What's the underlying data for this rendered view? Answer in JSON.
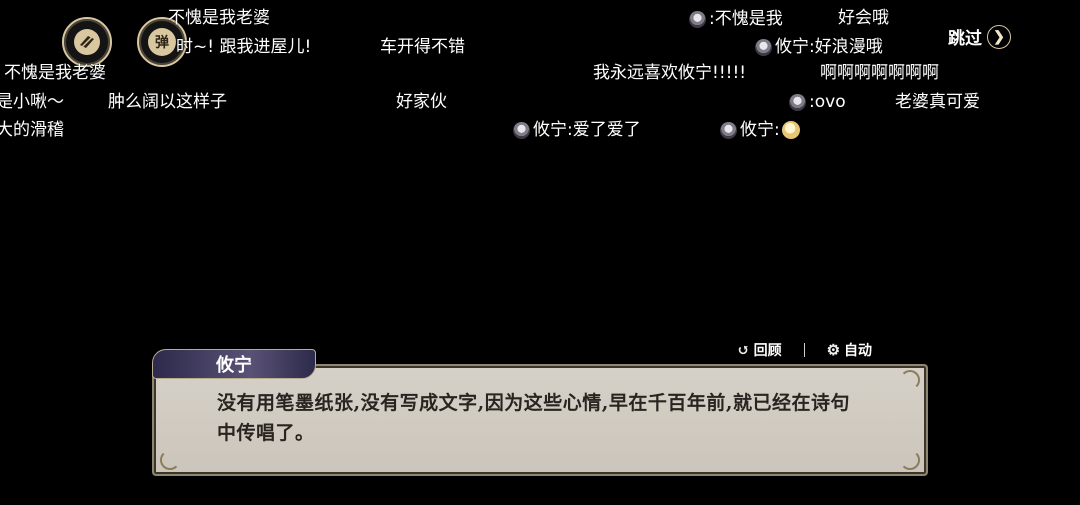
{
  "danmaku": [
    {
      "text": "不愧是我老婆",
      "avatar": false
    },
    {
      "text": "时~!  跟我进屋儿!",
      "avatar": false
    },
    {
      "text": "车开得不错",
      "avatar": false
    },
    {
      "text": "不愧是我老婆",
      "avatar": false
    },
    {
      "text": "是小啾～",
      "avatar": false
    },
    {
      "text": "肿么阔以这样子",
      "avatar": false
    },
    {
      "text": "好家伙",
      "avatar": false
    },
    {
      "text": "大的滑稽",
      "avatar": false
    },
    {
      "text": ":不愧是我",
      "avatar": true
    },
    {
      "text": "好会哦",
      "avatar": false
    },
    {
      "text": "攸宁:好浪漫哦",
      "avatar": true
    },
    {
      "text": "我永远喜欢攸宁!!!!!",
      "avatar": false
    },
    {
      "text": "啊啊啊啊啊啊啊",
      "avatar": false
    },
    {
      "text": ":ovo",
      "avatar": true
    },
    {
      "text": "老婆真可爱",
      "avatar": false
    },
    {
      "text": "攸宁:爱了爱了",
      "avatar": true
    },
    {
      "text": "攸宁:",
      "avatar": true,
      "emoji": true
    }
  ],
  "buttons": {
    "story_icon": "book-feather-icon",
    "danmaku_toggle": "弹",
    "skip": "跳过",
    "review": "回顾",
    "auto": "自动"
  },
  "dialog": {
    "speaker": "攸宁",
    "text": "没有用笔墨纸张,没有写成文字,因为这些心情,早在千百年前,就已经在诗句中传唱了。"
  }
}
